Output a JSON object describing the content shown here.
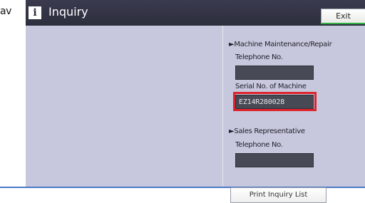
{
  "fragment_text": "av",
  "header": {
    "title": "Inquiry",
    "info_icon": "i",
    "exit_label": "Exit"
  },
  "machine_section": {
    "heading": "►Machine Maintenance/Repair",
    "telephone_label": "Telephone No.",
    "telephone_value": "",
    "serial_label": "Serial No. of Machine",
    "serial_value": "EZ14R280028"
  },
  "sales_section": {
    "heading": "►Sales Representative",
    "telephone_label": "Telephone No.",
    "telephone_value": ""
  },
  "print_button_label": "Print Inquiry List",
  "colors": {
    "background": "#c7c8dd",
    "titlebar": "#2c2d3d",
    "field": "#474a55",
    "highlight": "#e0232b"
  }
}
